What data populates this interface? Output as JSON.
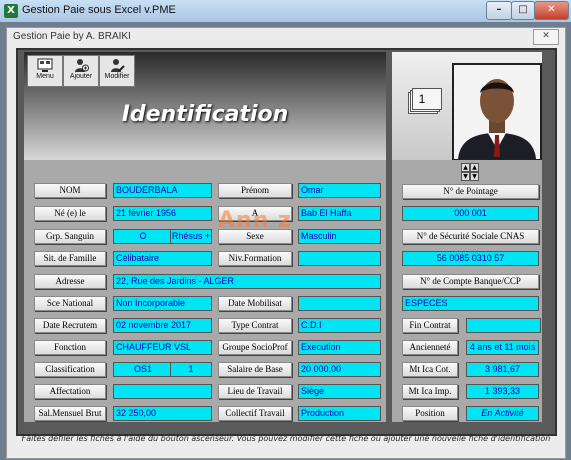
{
  "window": {
    "title": "Gestion Paie sous Excel v.PME",
    "app_icon": "X",
    "min": "–",
    "max": "□",
    "close": "✕"
  },
  "dialog": {
    "title": "Gestion Paie by A. BRAIKI",
    "close": "✕"
  },
  "header": {
    "title": "Identification"
  },
  "toolbar": {
    "menu": "Menu",
    "add": "Ajouter",
    "edit": "Modifier"
  },
  "card_number": "1",
  "fields": {
    "nom": {
      "label": "NOM",
      "value": "BOUDERBALA"
    },
    "prenom": {
      "label": "Prénom",
      "value": "Omar"
    },
    "ne_le": {
      "label": "Né (e)  le",
      "value": "21 février 1956"
    },
    "a": {
      "label": "A",
      "value": "Bab El Haffa"
    },
    "grp_sanguin": {
      "label": "Grp. Sanguin",
      "value": "O",
      "value2": "Rhésus +"
    },
    "sexe": {
      "label": "Sexe",
      "value": "Masculin"
    },
    "sit_famille": {
      "label": "Sit. de Famille",
      "value": "Célibataire"
    },
    "niv_formation": {
      "label": "Niv.Formation",
      "value": ""
    },
    "adresse": {
      "label": "Adresse",
      "value": "22, Rue des Jardins - ALGER"
    },
    "sce_national": {
      "label": "Sce National",
      "value": "Non Incorporable"
    },
    "date_mobilisat": {
      "label": "Date Mobilisat",
      "value": ""
    },
    "date_recrutem": {
      "label": "Date Recrutem",
      "value": "02 novembre 2017"
    },
    "type_contrat": {
      "label": "Type Contrat",
      "value": "C.D.I"
    },
    "fonction": {
      "label": "Fonction",
      "value": "CHAUFFEUR VSL"
    },
    "groupe_socio": {
      "label": "Groupe SocioProf",
      "value": "Execution"
    },
    "classification": {
      "label": "Classification",
      "value": "OS1",
      "value2": "1"
    },
    "salaire_base": {
      "label": "Salaire de Base",
      "value": "20 000,00"
    },
    "affectation": {
      "label": "Affectation",
      "value": ""
    },
    "lieu_travail": {
      "label": "Lieu de Travail",
      "value": "Siège"
    },
    "sal_mensuel": {
      "label": "Sal.Mensuel Brut",
      "value": "32 250,00"
    },
    "collectif": {
      "label": "Collectif Travail",
      "value": "Production"
    }
  },
  "right": {
    "pointage": {
      "label": "N° de Pointage",
      "value": "000 001"
    },
    "secu": {
      "label": "N° de Sécurité Sociale CNAS",
      "value": "56  0085  0310  57"
    },
    "compte": {
      "label": "N° de Compte Banque/CCP",
      "value": "ESPECES"
    },
    "fin_contrat": {
      "label": "Fin Contrat",
      "value": ""
    },
    "anciennete": {
      "label": "Ancienneté",
      "value": "4 ans et 11 mois"
    },
    "mt_ica_cot": {
      "label": "Mt Ica Cot.",
      "value": "3 981,67"
    },
    "mt_ica_imp": {
      "label": "Mt Ica Imp.",
      "value": "1 393,33"
    },
    "position": {
      "label": "Position",
      "value": "En Activité"
    }
  },
  "watermark": "Ann  z",
  "footer": "Faites défiler les fiches à l'aide du bouton ascenseur. Vous pouvez modifier cette fiche ou ajouter une nouvelle fiche d'identification"
}
